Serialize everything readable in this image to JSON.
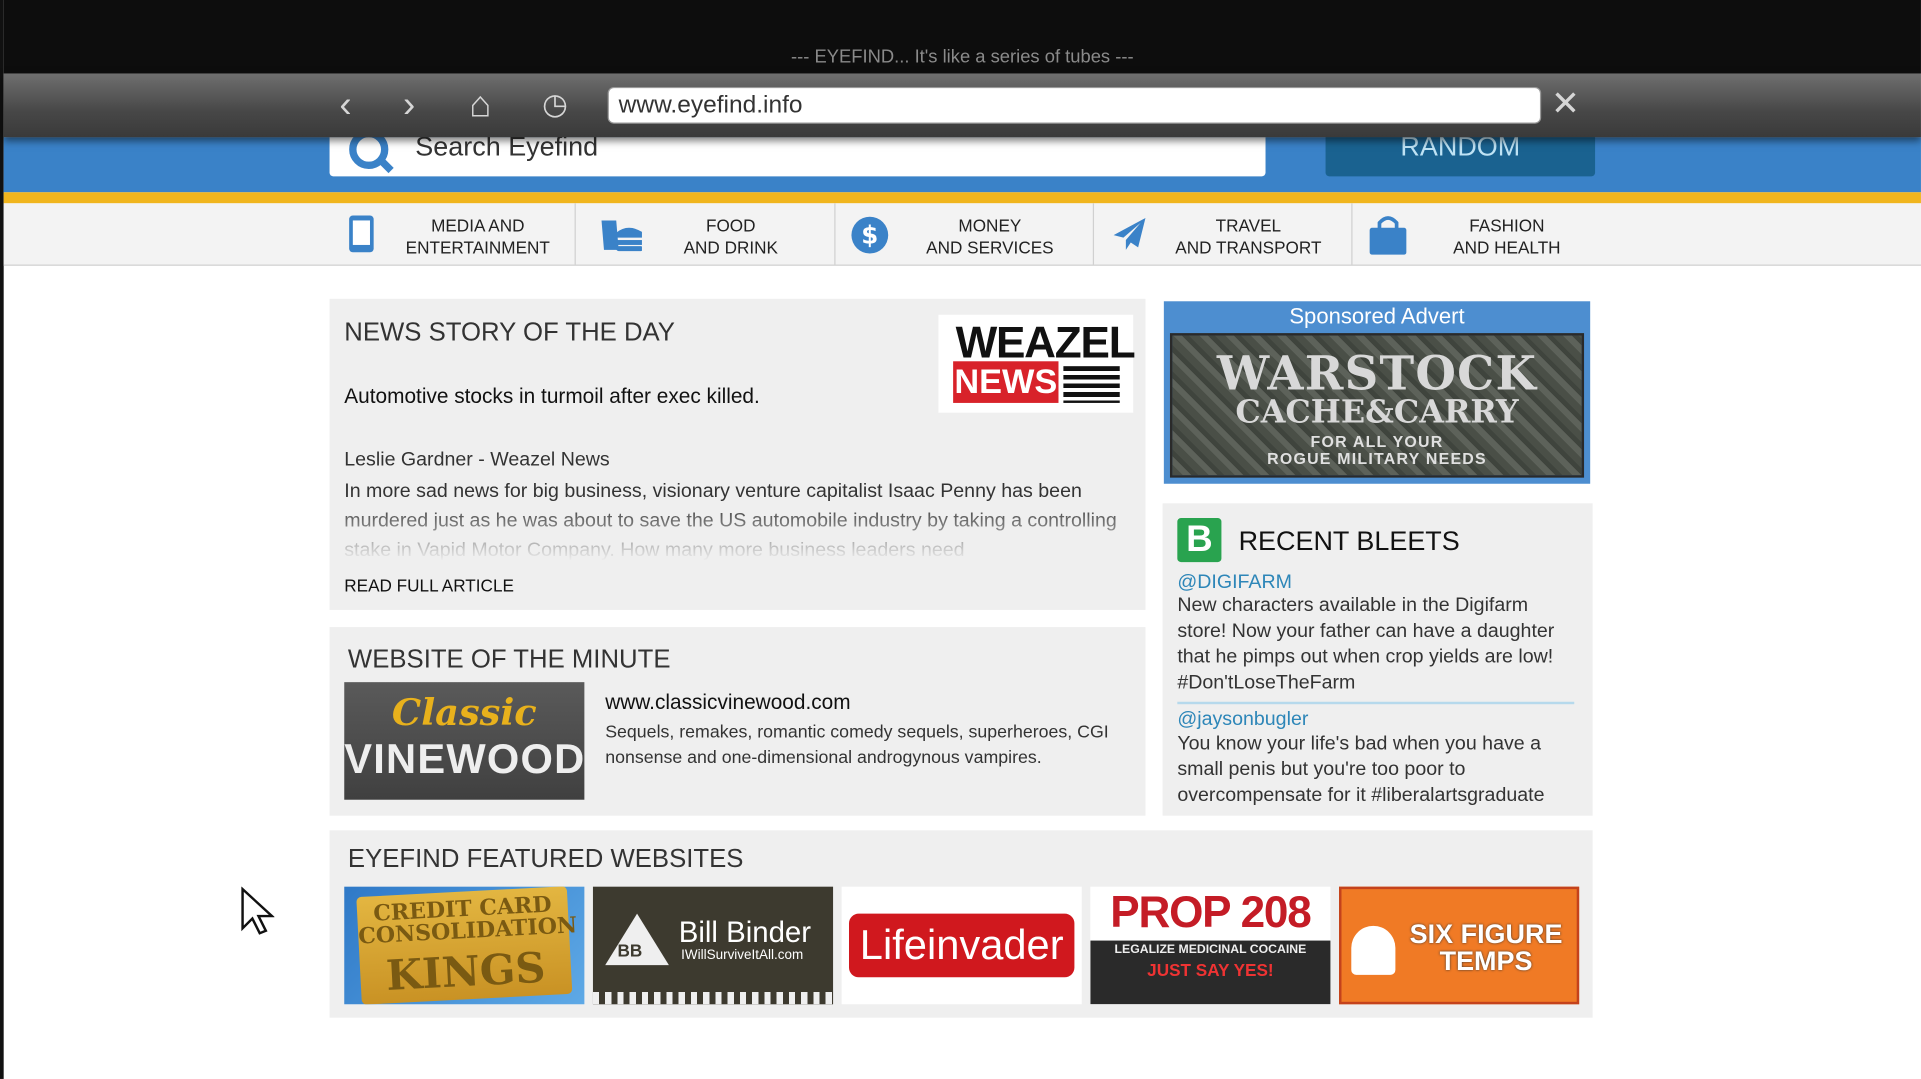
{
  "window": {
    "title": "--- EYEFIND... It's like a series of tubes ---"
  },
  "browser": {
    "back_icon": "‹",
    "forward_icon": "›",
    "home_icon": "⌂",
    "history_icon": "◷",
    "url": "www.eyefind.info",
    "close_icon": "✕"
  },
  "header": {
    "search_placeholder": "Search Eyefind",
    "random_label": "RANDOM"
  },
  "categories": [
    {
      "line1": "MEDIA AND",
      "line2": "ENTERTAINMENT",
      "icon": "tablet-icon"
    },
    {
      "line1": "FOOD",
      "line2": "AND DRINK",
      "icon": "food-icon"
    },
    {
      "line1": "MONEY",
      "line2": "AND SERVICES",
      "icon": "dollar-icon"
    },
    {
      "line1": "TRAVEL",
      "line2": "AND TRANSPORT",
      "icon": "plane-icon"
    },
    {
      "line1": "FASHION",
      "line2": "AND HEALTH",
      "icon": "bag-icon"
    }
  ],
  "news": {
    "heading": "NEWS STORY OF THE DAY",
    "headline": "Automotive stocks in turmoil after exec killed.",
    "byline": "Leslie Gardner - Weazel News",
    "excerpt": "In more sad news for big business, visionary venture capitalist Isaac Penny has been murdered just as he was about to save the US automobile industry by taking a controlling stake in Vapid Motor Company. How many more business leaders need",
    "read_more": "READ FULL ARTICLE",
    "logo_top": "WEAZEL",
    "logo_bottom": "NEWS"
  },
  "advert": {
    "heading": "Sponsored Advert",
    "line1": "WARSTOCK",
    "line2": "CACHE&CARRY",
    "line3": "FOR ALL YOUR",
    "line4": "ROGUE MILITARY NEEDS"
  },
  "bleets": {
    "heading": "RECENT BLEETS",
    "icon_letter": "B",
    "items": [
      {
        "handle": "@DIGIFARM",
        "text": "New characters available in the Digifarm store! Now your father can have a daughter that he pimps out when crop yields are low! #Don'tLoseTheFarm"
      },
      {
        "handle": "@jaysonbugler",
        "text": "You know your life's bad when you have a small penis but you're too poor to overcompensate for it #liberalartsgraduate"
      }
    ]
  },
  "website_of_minute": {
    "heading": "WEBSITE OF THE MINUTE",
    "logo_top": "Classic",
    "logo_bottom": "VINEWOOD",
    "url": "www.classicvinewood.com",
    "description": "Sequels, remakes, romantic comedy sequels, superheroes, CGI nonsense and one-dimensional androgynous vampires."
  },
  "featured": {
    "heading": "EYEFIND FEATURED WEBSITES",
    "sites": [
      {
        "line1": "CREDIT CARD",
        "line2": "CONSOLIDATION",
        "line3": "KINGS"
      },
      {
        "mark": "BB",
        "name": "Bill Binder",
        "sub": "IWillSurviveItAll.com"
      },
      {
        "name": "Lifeinvader"
      },
      {
        "name": "PROP 208",
        "sub": "LEGALIZE MEDICINAL COCAINE",
        "slogan": "JUST SAY YES!"
      },
      {
        "line1": "SIX FIGURE",
        "line2": "TEMPS"
      }
    ]
  },
  "colors": {
    "brand_blue": "#3a82c8",
    "accent_yellow": "#f0b51e",
    "random_button": "#1a6290",
    "link": "#2d86b8"
  }
}
